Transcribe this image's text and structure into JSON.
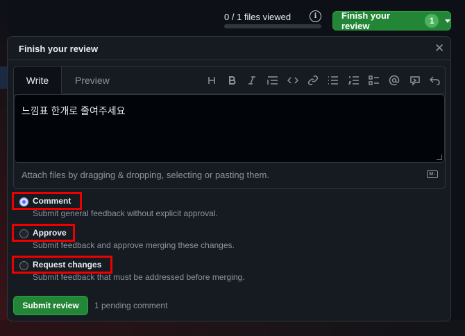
{
  "topbar": {
    "files_viewed": "0 / 1 files viewed",
    "progress": 0,
    "finish_label": "Finish your review",
    "finish_count": "1"
  },
  "panel": {
    "title": "Finish your review",
    "tabs": {
      "write": "Write",
      "preview": "Preview"
    },
    "toolbar_icons": [
      "heading-icon",
      "bold-icon",
      "italic-icon",
      "quote-icon",
      "code-icon",
      "link-icon",
      "unordered-list-icon",
      "ordered-list-icon",
      "task-list-icon",
      "mention-icon",
      "reference-icon",
      "undo-icon"
    ],
    "comment_text": "느낌표 한개로 줄여주세요",
    "attach_hint": "Attach files by dragging & dropping, selecting or pasting them.",
    "markdown_badge": "M↓",
    "options": [
      {
        "label": "Comment",
        "desc": "Submit general feedback without explicit approval.",
        "checked": true
      },
      {
        "label": "Approve",
        "desc": "Submit feedback and approve merging these changes.",
        "checked": false
      },
      {
        "label": "Request changes",
        "desc": "Submit feedback that must be addressed before merging.",
        "checked": false
      }
    ],
    "submit_label": "Submit review",
    "pending_text": "1 pending comment"
  },
  "colors": {
    "accent_green": "#238636",
    "highlight_red": "#ee0000",
    "radio_checked": "#4f6bff"
  }
}
